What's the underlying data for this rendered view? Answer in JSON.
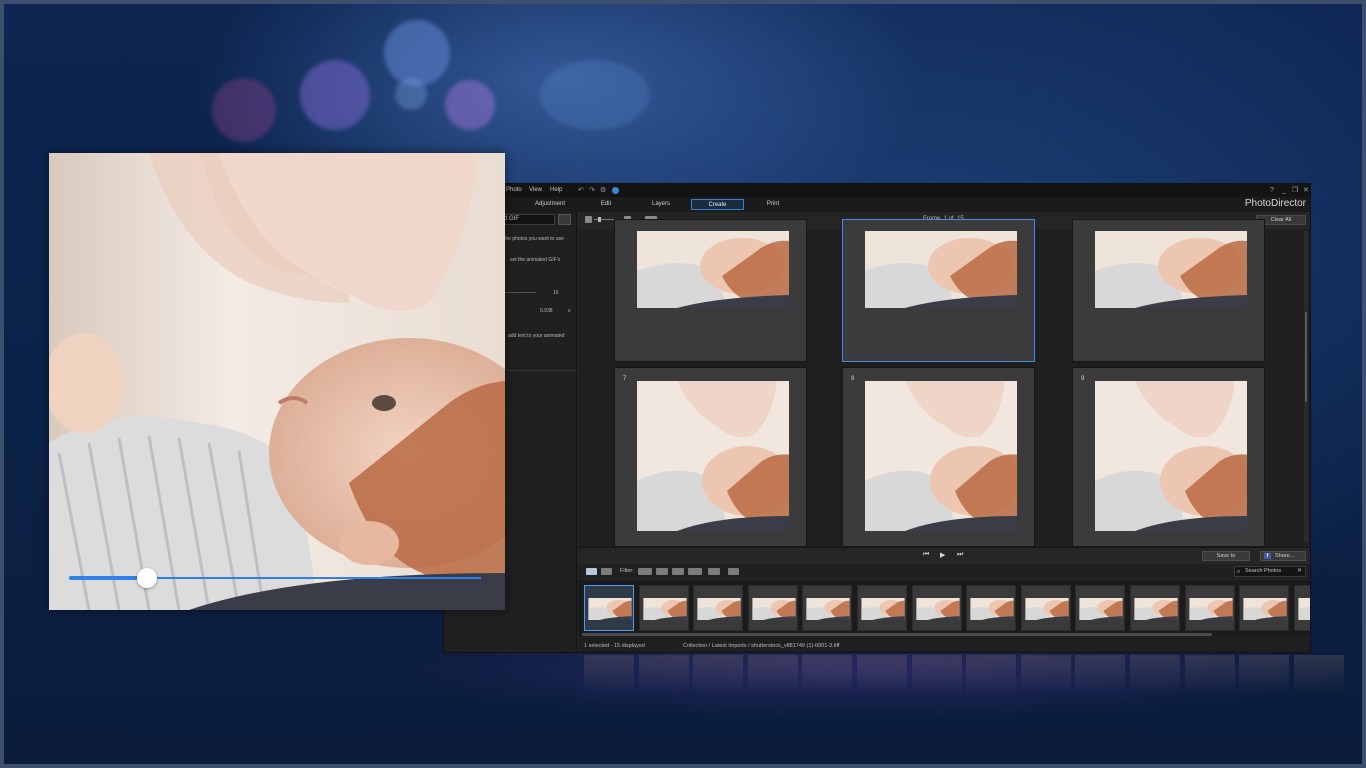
{
  "app": {
    "brand": "PhotoDirector",
    "menu": [
      "Photo",
      "View",
      "Help"
    ],
    "window_controls": [
      "?",
      "_",
      "❐",
      "✕"
    ],
    "tabs": [
      {
        "label": "Adjustment",
        "active": false
      },
      {
        "label": "Edit",
        "active": false
      },
      {
        "label": "Layers",
        "active": false
      },
      {
        "label": "Create",
        "active": true
      },
      {
        "label": "Print",
        "active": false
      }
    ],
    "accent_color": "#2f82d8"
  },
  "left_panel": {
    "title_field": "d GIF",
    "instruction_1": "the photos you want to use",
    "instruction_2": "set the animated GIF's",
    "frames_value": "16",
    "duration_value": "0.938",
    "duration_unit": "s",
    "instruction_3": "add text to your animated"
  },
  "viewer": {
    "frame_label": "Frame",
    "frame_current": "1",
    "frame_of": "of",
    "frame_total": "15",
    "clear_all": "Clear All",
    "cells": [
      {
        "number": "",
        "selected": false
      },
      {
        "number": "",
        "selected": true
      },
      {
        "number": "",
        "selected": false
      },
      {
        "number": "7",
        "selected": false
      },
      {
        "number": "8",
        "selected": false
      },
      {
        "number": "9",
        "selected": false
      }
    ]
  },
  "playback": {
    "prev_icon": "skip-previous-icon",
    "play_icon": "play-icon",
    "next_icon": "skip-next-icon",
    "save_to": "Save to",
    "share": "Share...",
    "facebook_glyph": "f"
  },
  "filter": {
    "label": "Filter:",
    "search_placeholder": "Search Photos"
  },
  "filmstrip": {
    "thumb_count": 14,
    "selected_index": 0
  },
  "status": {
    "selection": "1 selected - 15 displayed",
    "path": "Collection / Latest Imports / shutterstock_v881749 (1)-0001-3.tiff"
  },
  "preview": {
    "progress": 0.19,
    "accent_color": "#2f80e8"
  }
}
